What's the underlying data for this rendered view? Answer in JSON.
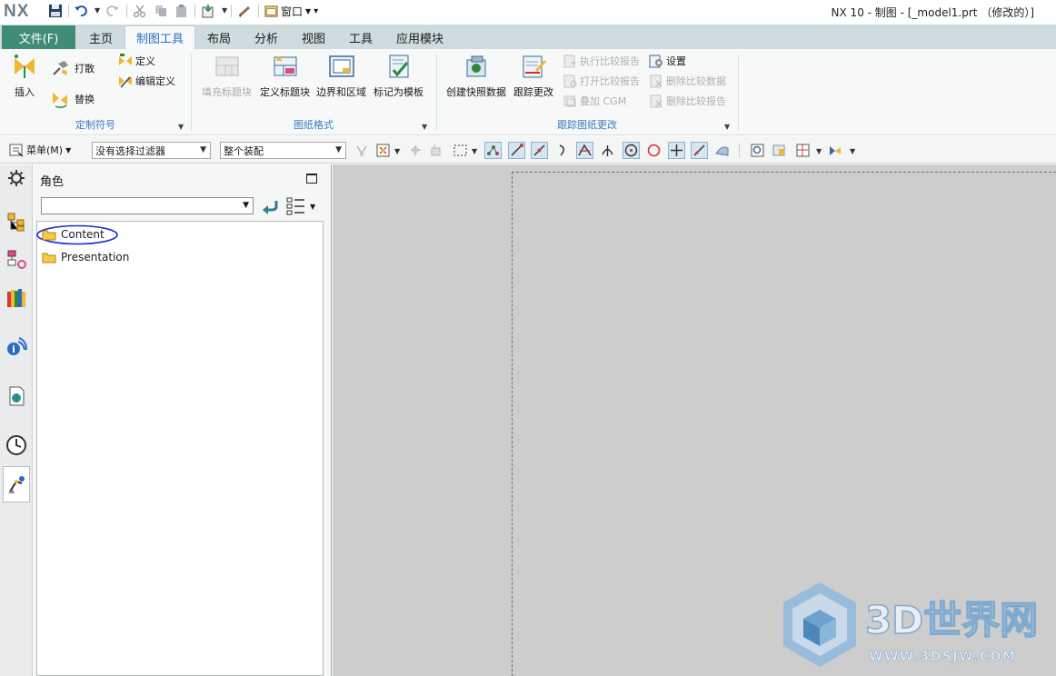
{
  "app": {
    "logo": "NX",
    "window_menu_label": "窗口",
    "title": "NX 10 - 制图 - [_model1.prt （修改的）]"
  },
  "ribbon": {
    "file_tab": "文件(F)",
    "tabs": [
      "主页",
      "制图工具",
      "布局",
      "分析",
      "视图",
      "工具",
      "应用模块"
    ],
    "active_tab": "制图工具",
    "groups": {
      "custom_symbol": {
        "label": "定制符号",
        "insert": "插入",
        "explode": "打散",
        "replace": "替换",
        "define": "定义",
        "edit_define": "编辑定义"
      },
      "drawing_format": {
        "label": "图纸格式",
        "fill_title_block": "填充标题块",
        "define_title_block": "定义标题块",
        "borders_zones": "边界和区域",
        "mark_as_template": "标记为模板"
      },
      "track_changes": {
        "label": "跟踪图纸更改",
        "create_snapshot": "创建快照数据",
        "track_changes": "跟踪更改",
        "run_compare_report": "执行比较报告",
        "open_compare_report": "打开比较报告",
        "overlay_cgm": "叠加 CGM",
        "settings": "设置",
        "delete_compare_data": "删除比较数据",
        "delete_compare_report": "删除比较报告"
      }
    }
  },
  "selection_bar": {
    "menu_label": "菜单(M)",
    "filter_value": "没有选择过滤器",
    "scope_value": "整个装配"
  },
  "navigator": {
    "title": "角色",
    "combo_value": "",
    "items": [
      {
        "label": "Content"
      },
      {
        "label": "Presentation"
      }
    ]
  },
  "watermark": {
    "brand": "3D世界网",
    "url": "WWW.3DSJW.COM"
  },
  "colors": {
    "file_tab": "#3f8d77",
    "tab_bar": "#cfdcdf",
    "active_tab_text": "#2a6cc4",
    "group_label": "#3a7cc0",
    "graphics_bg": "#cdcdcd",
    "annotation_circle": "#1b2bd8"
  }
}
